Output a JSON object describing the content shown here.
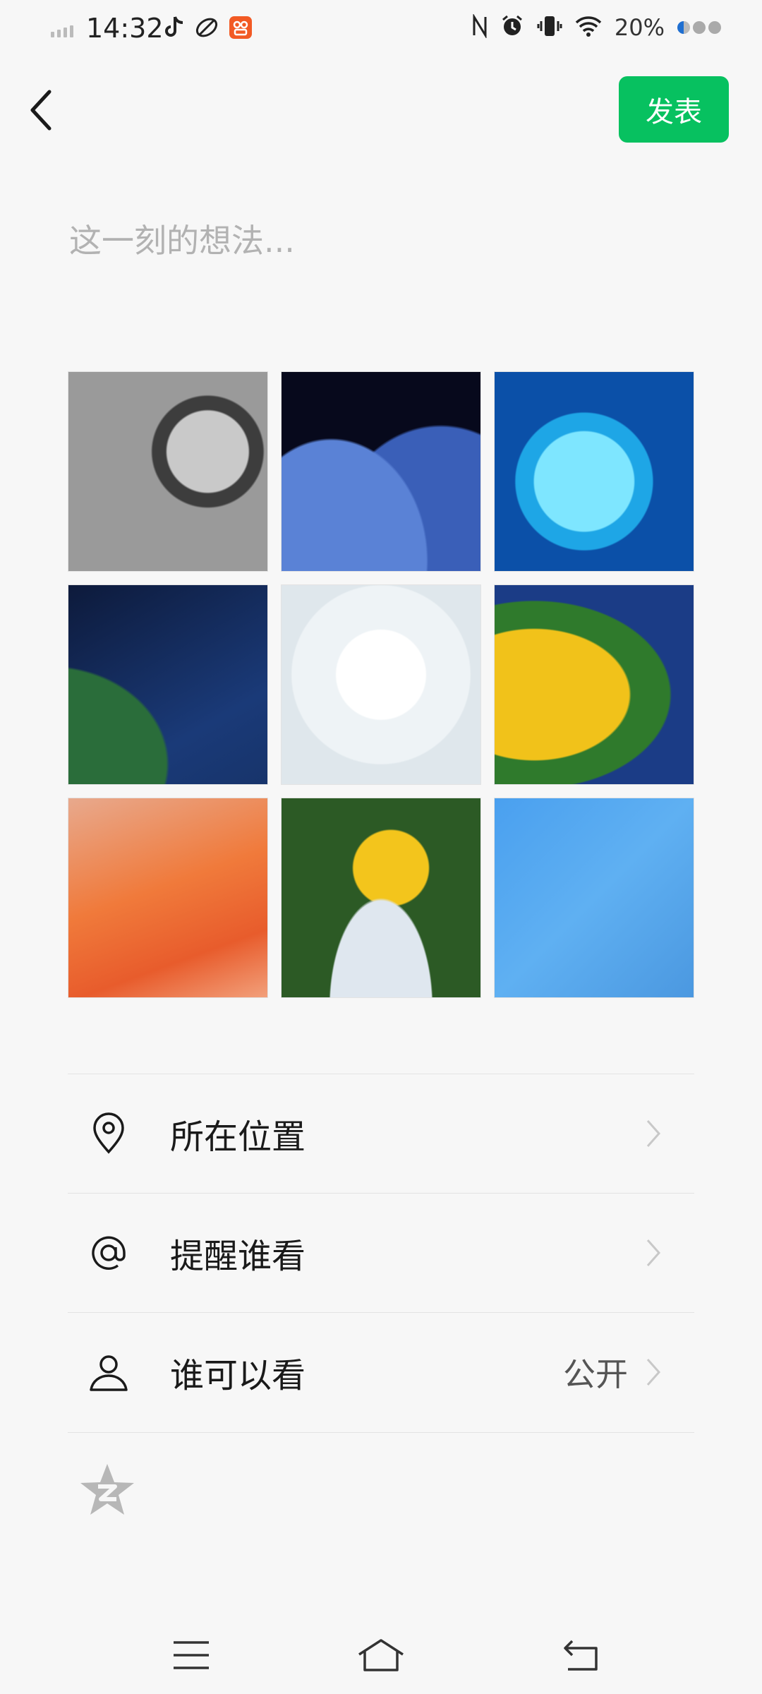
{
  "status_bar": {
    "time": "14:32",
    "battery_percent": "20%",
    "icons": [
      "signal-icon",
      "tiktok-icon",
      "leaf-app-icon",
      "orange-app-icon",
      "nfc-icon",
      "alarm-icon",
      "vibrate-icon",
      "wifi-icon",
      "battery-dots-icon"
    ]
  },
  "header": {
    "publish_label": "发表"
  },
  "composer": {
    "placeholder": "这一刻的想法..."
  },
  "photos": [
    {
      "name": "photo-1",
      "description": "chrome gear ring"
    },
    {
      "name": "photo-2",
      "description": "night sky clouds"
    },
    {
      "name": "photo-3",
      "description": "stained glass moon"
    },
    {
      "name": "photo-4",
      "description": "night birds forest"
    },
    {
      "name": "photo-5",
      "description": "anime character"
    },
    {
      "name": "photo-6",
      "description": "yellow flowers"
    },
    {
      "name": "photo-7",
      "description": "orange sky"
    },
    {
      "name": "photo-8",
      "description": "yellow petals"
    },
    {
      "name": "photo-9",
      "description": "blue sky birds"
    }
  ],
  "options": {
    "location": {
      "label": "所在位置",
      "icon": "location-pin-icon"
    },
    "remind": {
      "label": "提醒谁看",
      "icon": "at-icon"
    },
    "visibility": {
      "label": "谁可以看",
      "value": "公开",
      "icon": "person-icon"
    }
  },
  "extras": {
    "qzone_icon": "qzone-star-icon"
  },
  "colors": {
    "accent": "#07c160",
    "background": "#f7f7f7",
    "placeholder": "#b2b2b2",
    "divider": "#e3e3e3"
  },
  "nav_bar": {
    "icons": [
      "menu-icon",
      "home-icon",
      "back-icon"
    ]
  }
}
